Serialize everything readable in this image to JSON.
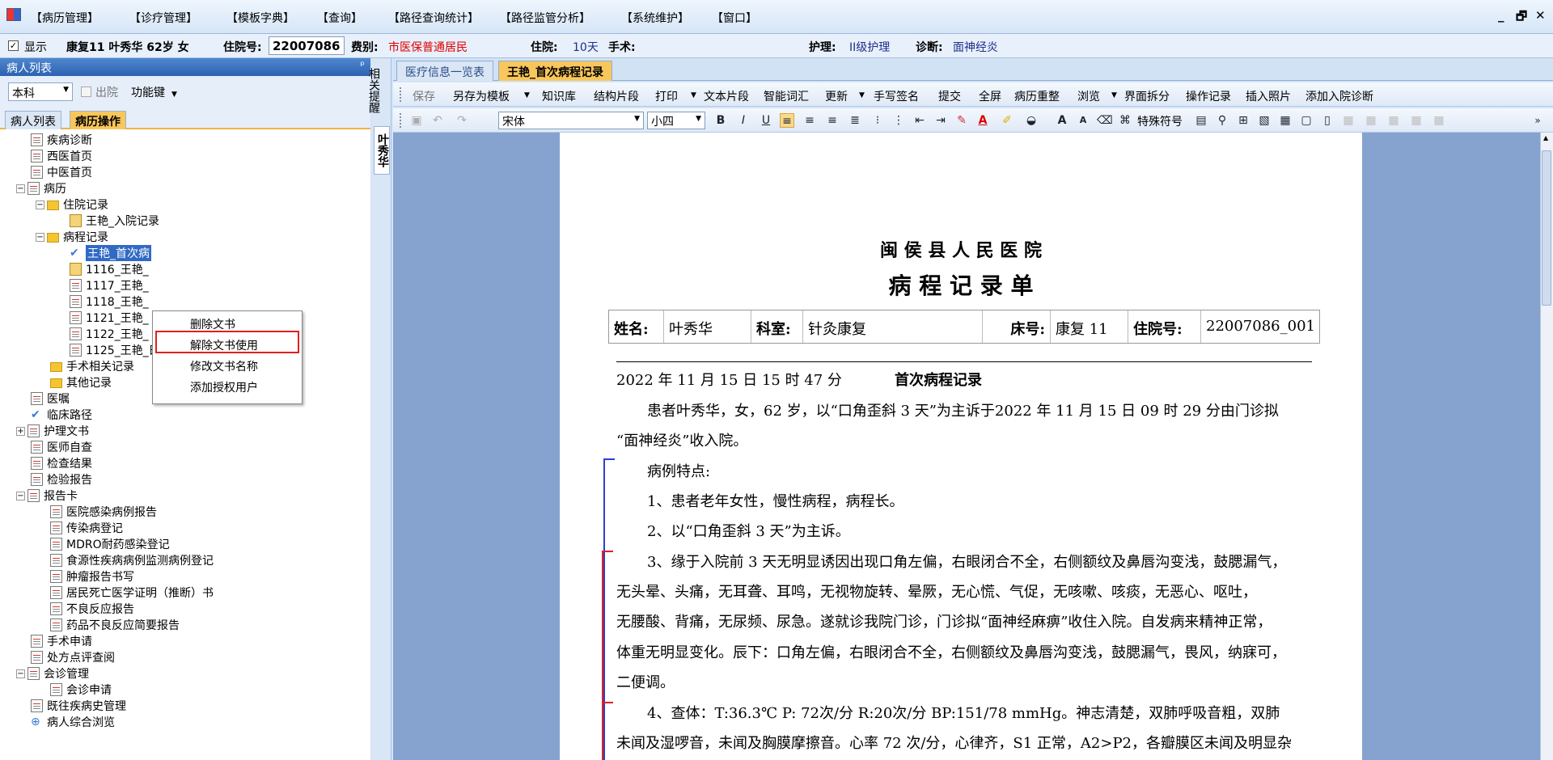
{
  "menu": [
    "【病历管理】",
    "【诊疗管理】",
    "【模板字典】",
    "【查询】",
    "【路径查询统计】",
    "【路径监管分析】",
    "【系统维护】",
    "【窗口】"
  ],
  "window_controls": [
    "_",
    "🗗",
    "✕"
  ],
  "patient_bar": {
    "show_label": "显示",
    "name": "康复11  叶秀华  62岁  女",
    "admission_label": "住院号:",
    "admission_no": "22007086",
    "fee_label": "费别:",
    "fee_value": "市医保普通居民",
    "stay_label": "住院:",
    "stay_value": "10天",
    "surgery_label": "手术:",
    "nursing_label": "护理:",
    "nursing_value": "II级护理",
    "diagnosis_label": "诊断:",
    "diagnosis_value": "面神经炎"
  },
  "left_panel": {
    "title": "病人列表",
    "pin": "ᵖ",
    "dept": "本科",
    "discharged_label": "出院",
    "func_key": "功能键",
    "tabs": [
      "病人列表",
      "病历操作"
    ]
  },
  "tree": [
    {
      "label": "疾病诊断"
    },
    {
      "label": "西医首页"
    },
    {
      "label": "中医首页"
    },
    {
      "label": "病历"
    },
    {
      "label": "住院记录"
    },
    {
      "label": "王艳_入院记录"
    },
    {
      "label": "病程记录"
    },
    {
      "label": "王艳_首次病"
    },
    {
      "label": "1116_王艳_"
    },
    {
      "label": "1117_王艳_"
    },
    {
      "label": "1118_王艳_"
    },
    {
      "label": "1121_王艳_"
    },
    {
      "label": "1122_王艳_"
    },
    {
      "label": "1125_王艳_日常病程记录"
    },
    {
      "label": "手术相关记录"
    },
    {
      "label": "其他记录"
    },
    {
      "label": "医嘱"
    },
    {
      "label": "临床路径"
    },
    {
      "label": "护理文书"
    },
    {
      "label": "医师自查"
    },
    {
      "label": "检查结果"
    },
    {
      "label": "检验报告"
    },
    {
      "label": "报告卡"
    },
    {
      "label": "医院感染病例报告"
    },
    {
      "label": "传染病登记"
    },
    {
      "label": "MDRO耐药感染登记"
    },
    {
      "label": "食源性疾病病例监测病例登记"
    },
    {
      "label": "肿瘤报告书写"
    },
    {
      "label": "居民死亡医学证明（推断）书"
    },
    {
      "label": "不良反应报告"
    },
    {
      "label": "药品不良反应简要报告"
    },
    {
      "label": "手术申请"
    },
    {
      "label": "处方点评查阅"
    },
    {
      "label": "会诊管理"
    },
    {
      "label": "会诊申请"
    },
    {
      "label": "既往疾病史管理"
    },
    {
      "label": "病人综合浏览"
    }
  ],
  "context_menu": [
    "删除文书",
    "解除文书使用",
    "修改文书名称",
    "添加授权用户"
  ],
  "vertical_tabs": [
    "相关提醒",
    "叶秀华"
  ],
  "doc_tabs": [
    "医疗信息一览表",
    "王艳_首次病程记录"
  ],
  "toolbar1": [
    "保存",
    "另存为模板",
    "知识库",
    "结构片段",
    "打印",
    "文本片段",
    "智能词汇",
    "更新",
    "手写签名",
    "提交",
    "全屏",
    "病历重整",
    "浏览",
    "界面拆分",
    "操作记录",
    "插入照片",
    "添加入院诊断"
  ],
  "toolbar2": {
    "font": "宋体",
    "size": "小四",
    "special": "特殊符号"
  },
  "document": {
    "hospital": "闽 侯 县 人 民 医 院",
    "title": "病 程 记 录 单",
    "header": {
      "name_label": "姓名:",
      "name": "叶秀华",
      "dept_label": "科室:",
      "dept": "针灸康复",
      "bed_label": "床号:",
      "bed": "康复 11",
      "adm_label": "住院号:",
      "adm": "22007086_001"
    },
    "datetime": "2022 年 11 月 15 日 15 时 47 分",
    "record_title": "首次病程记录",
    "lines": [
      "患者叶秀华，女，62 岁，以“口角歪斜 3 天”为主诉于2022 年 11 月 15 日 09 时 29 分由门诊拟",
      "“面神经炎”收入院。",
      "病例特点:",
      "1、患者老年女性，慢性病程，病程长。",
      "2、以“口角歪斜 3 天”为主诉。",
      "3、缘于入院前 3 天无明显诱因出现口角左偏，右眼闭合不全，右侧额纹及鼻唇沟变浅，鼓腮漏气，",
      "无头晕、头痛，无耳聋、耳鸣，无视物旋转、晕厥，无心慌、气促，无咳嗽、咳痰，无恶心、呕吐，",
      "无腰酸、背痛，无尿频、尿急。遂就诊我院门诊，门诊拟“面神经麻痹”收住入院。自发病来精神正常，",
      "体重无明显变化。辰下：口角左偏，右眼闭合不全，右侧额纹及鼻唇沟变浅，鼓腮漏气，畏风，纳寐可，",
      "二便调。",
      "4、查体：T:36.3℃   P: 72次/分   R:20次/分   BP:151/78 mmHg。神志清楚，双肺呼吸音粗，双肺",
      "未闻及湿啰音，未闻及胸膜摩擦音。心率 72 次/分，心律齐，S1 正常，A2>P2，各瓣膜区未闻及明显杂"
    ]
  }
}
